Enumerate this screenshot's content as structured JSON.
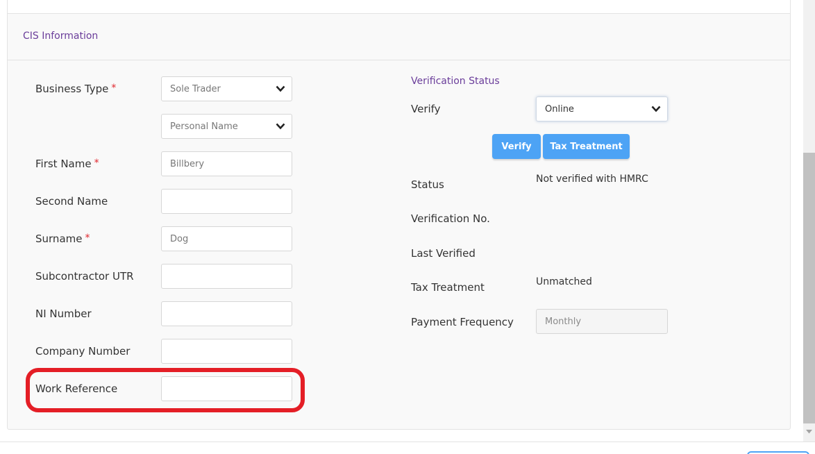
{
  "panel": {
    "title": "CIS Information"
  },
  "left": {
    "business_type": {
      "label": "Business Type",
      "required_mark": "*",
      "value": "Sole Trader",
      "sub_value": "Personal Name"
    },
    "first_name": {
      "label": "First Name",
      "required_mark": "*",
      "placeholder": "Billbery"
    },
    "second_name": {
      "label": "Second Name",
      "value": ""
    },
    "surname": {
      "label": "Surname",
      "required_mark": "*",
      "placeholder": "Dog"
    },
    "subcontractor_utr": {
      "label": "Subcontractor UTR",
      "value": ""
    },
    "ni_number": {
      "label": "NI Number",
      "value": ""
    },
    "company_number": {
      "label": "Company Number",
      "value": ""
    },
    "work_reference": {
      "label": "Work Reference",
      "value": ""
    }
  },
  "right": {
    "section_title": "Verification Status",
    "verify": {
      "label": "Verify",
      "value": "Online"
    },
    "buttons": {
      "verify": "Verify",
      "tax_treatment": "Tax Treatment"
    },
    "status": {
      "label": "Status",
      "value": "Not verified with HMRC"
    },
    "verification_no": {
      "label": "Verification No.",
      "value": ""
    },
    "last_verified": {
      "label": "Last Verified",
      "value": ""
    },
    "tax_treatment": {
      "label": "Tax Treatment",
      "value": "Unmatched"
    },
    "payment_frequency": {
      "label": "Payment Frequency",
      "value": "Monthly"
    }
  },
  "colors": {
    "accent_purple": "#6a3d9a",
    "button_blue": "#4da3f5",
    "highlight_red": "#e41e26",
    "required_red": "#e0262d"
  },
  "icons": {
    "select_arrow": "chevron-down-icon",
    "scroll_arrow": "scroll-down-arrow-icon"
  }
}
